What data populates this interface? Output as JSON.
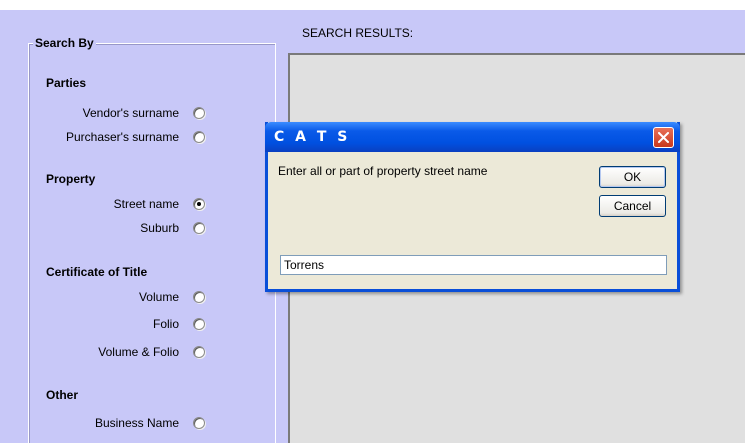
{
  "search_group": {
    "legend": "Search By",
    "sections": {
      "parties": "Parties",
      "property": "Property",
      "certificate": "Certificate of Title",
      "other": "Other"
    },
    "options": {
      "vendor": "Vendor's surname",
      "purchaser": "Purchaser's surname",
      "street": "Street name",
      "suburb": "Suburb",
      "volume": "Volume",
      "folio": "Folio",
      "volume_folio": "Volume & Folio",
      "business": "Business Name"
    },
    "selected": "Street name"
  },
  "results": {
    "title": "SEARCH RESULTS:"
  },
  "dialog": {
    "title": "C A T S",
    "prompt": "Enter all or part of property street name",
    "ok_label": "OK",
    "cancel_label": "Cancel",
    "input_value": "Torrens"
  },
  "icons": {
    "close": "close-icon",
    "radio": "radio-icon"
  },
  "colors": {
    "background": "#c8c8f8",
    "results_panel": "#e0e0e0",
    "dialog_title": "#0a5ae8",
    "close_button": "#d04828"
  }
}
